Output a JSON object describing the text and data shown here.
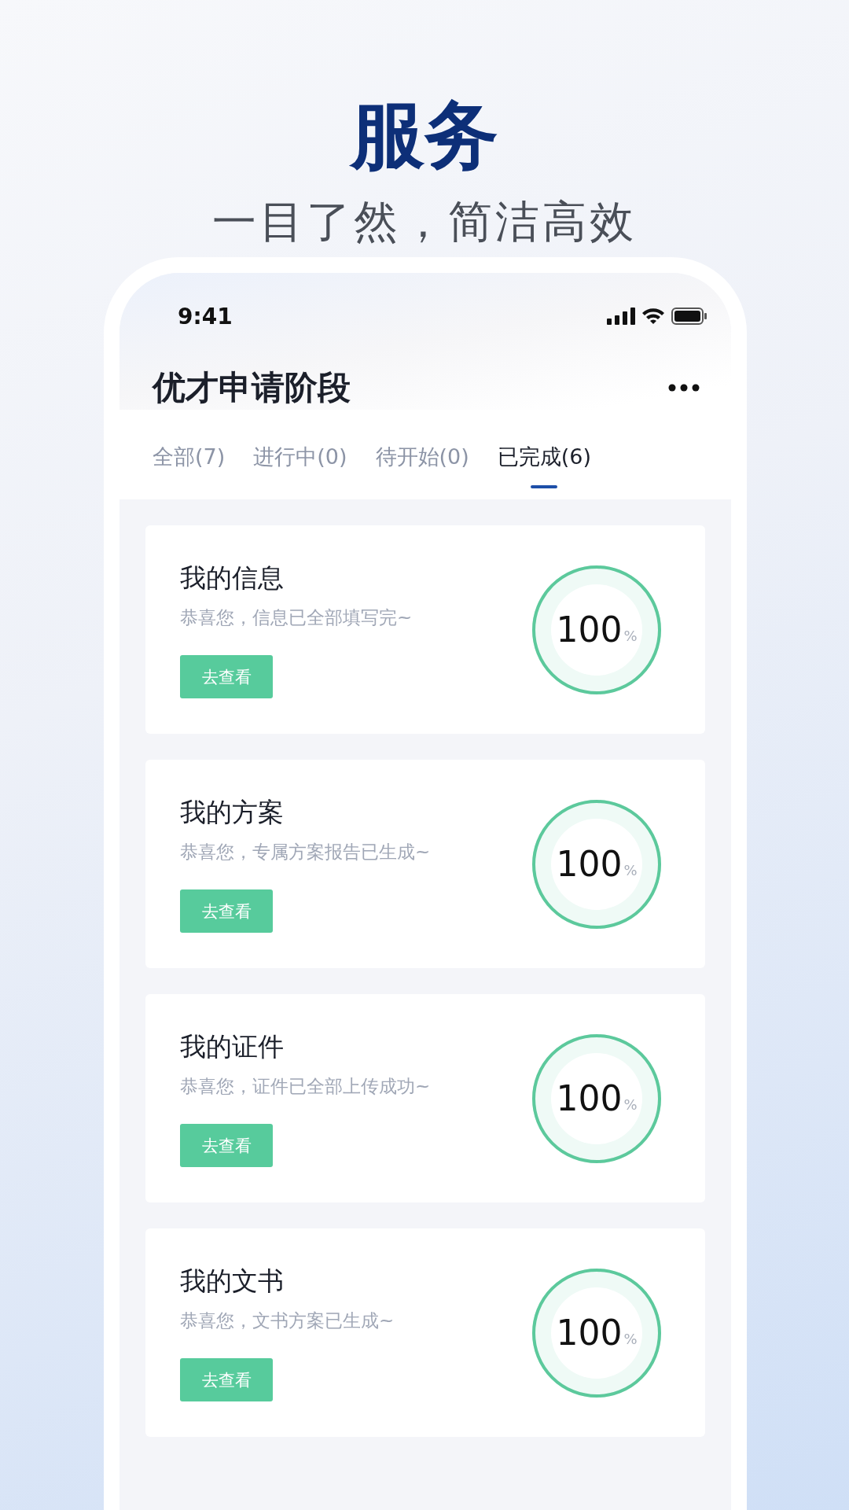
{
  "headline": {
    "title": "服务",
    "subtitle": "一目了然，简洁高效"
  },
  "status_bar": {
    "time": "9:41"
  },
  "header": {
    "title": "优才申请阶段"
  },
  "tabs": [
    {
      "label": "全部(7)",
      "selected": false
    },
    {
      "label": "进行中(0)",
      "selected": false
    },
    {
      "label": "待开始(0)",
      "selected": false
    },
    {
      "label": "已完成(6)",
      "selected": true
    }
  ],
  "cards": [
    {
      "title": "我的信息",
      "subtitle": "恭喜您，信息已全部填写完~",
      "button": "去查看",
      "percent": "100",
      "unit": "%",
      "level": 1
    },
    {
      "title": "我的方案",
      "subtitle": "恭喜您，专属方案报告已生成~",
      "button": "去查看",
      "percent": "100",
      "unit": "%",
      "level": 1
    },
    {
      "title": "我的证件",
      "subtitle": "恭喜您，证件已全部上传成功~",
      "button": "去查看",
      "percent": "100",
      "unit": "%",
      "level": 1
    },
    {
      "title": "我的文书",
      "subtitle": "恭喜您，文书方案已生成~",
      "button": "去查看",
      "percent": "100",
      "unit": "%",
      "level": 1
    }
  ]
}
